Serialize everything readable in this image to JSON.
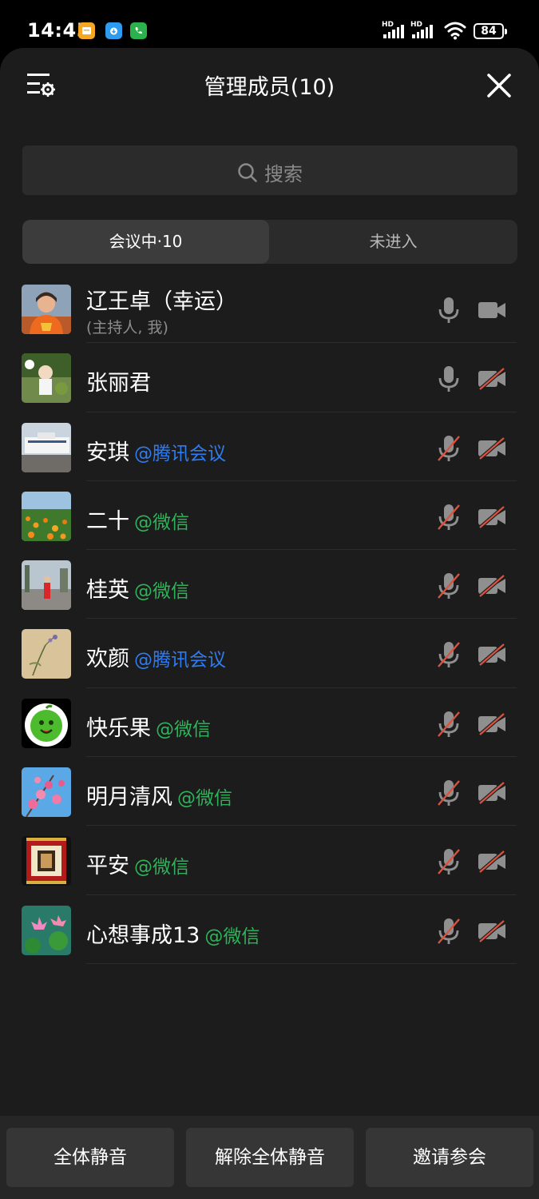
{
  "status_bar": {
    "time": "14:45",
    "battery": "84",
    "network_1": "HD",
    "network_2": "HD"
  },
  "header": {
    "title": "管理成员(10)"
  },
  "search": {
    "placeholder": "搜索"
  },
  "tabs": [
    {
      "label": "会议中·10",
      "active": true
    },
    {
      "label": "未进入",
      "active": false
    }
  ],
  "members": [
    {
      "name": "辽王卓（幸运）",
      "subtitle": "(主持人, 我)",
      "source": "",
      "source_type": "",
      "mic": "on",
      "camera": "on"
    },
    {
      "name": "张丽君",
      "subtitle": "",
      "source": "",
      "source_type": "",
      "mic": "on",
      "camera": "off"
    },
    {
      "name": "安琪",
      "subtitle": "",
      "source": "@腾讯会议",
      "source_type": "tencent",
      "mic": "off",
      "camera": "off"
    },
    {
      "name": "二十",
      "subtitle": "",
      "source": "@微信",
      "source_type": "wechat",
      "mic": "off",
      "camera": "off"
    },
    {
      "name": "桂英",
      "subtitle": "",
      "source": "@微信",
      "source_type": "wechat",
      "mic": "off",
      "camera": "off"
    },
    {
      "name": "欢颜",
      "subtitle": "",
      "source": "@腾讯会议",
      "source_type": "tencent",
      "mic": "off",
      "camera": "off"
    },
    {
      "name": "快乐果",
      "subtitle": "",
      "source": "@微信",
      "source_type": "wechat",
      "mic": "off",
      "camera": "off"
    },
    {
      "name": "明月清风",
      "subtitle": "",
      "source": "@微信",
      "source_type": "wechat",
      "mic": "off",
      "camera": "off"
    },
    {
      "name": "平安",
      "subtitle": "",
      "source": "@微信",
      "source_type": "wechat",
      "mic": "off",
      "camera": "off"
    },
    {
      "name": "心想事成13",
      "subtitle": "",
      "source": "@微信",
      "source_type": "wechat",
      "mic": "off",
      "camera": "off"
    }
  ],
  "bottom_buttons": {
    "mute_all": "全体静音",
    "unmute_all": "解除全体静音",
    "invite": "邀请参会"
  },
  "colors": {
    "wechat": "#2fb35a",
    "tencent": "#2f7cf0",
    "muted_slash": "#d9533f",
    "background": "#1c1c1c"
  }
}
